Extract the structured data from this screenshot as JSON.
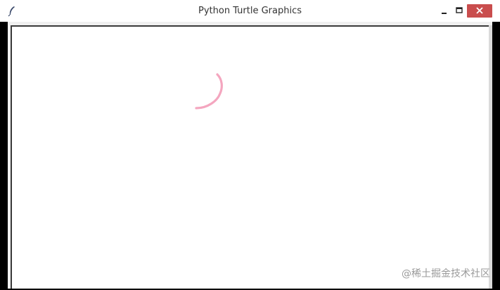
{
  "window": {
    "title": "Python Turtle Graphics",
    "close_color": "#c94d4d"
  },
  "icons": {
    "app": "feather-icon",
    "minimize": "minimize-icon",
    "maximize": "maximize-icon",
    "close": "close-icon"
  },
  "canvas": {
    "pen_color": "#f4a6bf"
  },
  "watermark": {
    "text": "@稀土掘金技术社区"
  }
}
